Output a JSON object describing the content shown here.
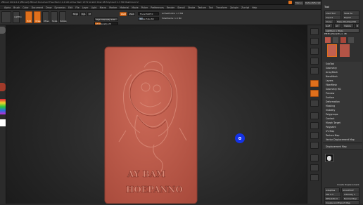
{
  "window": {
    "title": "ZBrush 2021.6.4 [ZBrush]  ZBrush Document  Free Mem 11.2 GB  Active Mem 1374  Scratch Disk 48  PolyCount 1.3 Mil  MeshCount 2",
    "right_buttons": [
      "Menus",
      "DefaultZScript"
    ]
  },
  "menubar": {
    "items": [
      "Alpha",
      "Brush",
      "Color",
      "Document",
      "Draw",
      "Dynamics",
      "Edit",
      "File",
      "Layer",
      "Light",
      "Macro",
      "Marker",
      "Material",
      "Movie",
      "Picker",
      "Preferences",
      "Render",
      "Stencil",
      "Stroke",
      "Texture",
      "Tool",
      "Transform",
      "Zplugin",
      "Zscript",
      "Help"
    ]
  },
  "toolbar": {
    "buttons": [
      "Edit",
      "Draw",
      "Move",
      "Scale",
      "Rotate"
    ],
    "mrgb": "Mrgb",
    "rgb": "Rgb",
    "m": "M",
    "zadd": "Zadd",
    "zsub": "Zsub",
    "lightbox": "LightBox",
    "rgb_intensity": "Rgb Intensity 100",
    "z_intensity": "Z Intensity 25",
    "focal_shift": "Focal Shift 0",
    "draw_size": "Draw Size 64",
    "active_points": "ActivePoints: 1.3 Mil",
    "total_points": "TotalPoints: 1.3 Mil"
  },
  "tray": {
    "title": "Tool",
    "top_buttons": [
      "Load Tool",
      "Save As",
      "Import",
      "Export",
      "Clone",
      "Make PolyMesh3D",
      "GoZ",
      "All",
      "Visible",
      "R"
    ],
    "lightbox_tools": "Lightbox > Tools",
    "current_tool": "PM3D_Plane3D_1. 48",
    "sections": [
      "SubTool",
      "Geometry",
      "ArrayMesh",
      "NanoMesh",
      "Layers",
      "FiberMesh",
      "Geometry HD",
      "Preview",
      "Surface",
      "Deformation",
      "Masking",
      "Visibility",
      "Polygroups",
      "Contact",
      "Morph Target",
      "Polypaint",
      "UV Map",
      "Texture Map",
      "Vector Displacement Map",
      "Displacement Map"
    ],
    "display_label": "Create Displacement",
    "adaptive": "Adaptive",
    "smooth_uv": "SmoothUV",
    "mid": "Mid 0.5",
    "intensity": "Intensity 1",
    "dpsubpix": "DPSubPix 0",
    "normal_map": "Normal Map",
    "export_map": "Create And Export Map"
  },
  "colors": {
    "accent": "#e0701c",
    "clay": "#c1604f",
    "pointer": "#1432e6"
  },
  "relief": {
    "caption_line1": "AY BAM",
    "caption_line2": "HOEPANNO"
  }
}
